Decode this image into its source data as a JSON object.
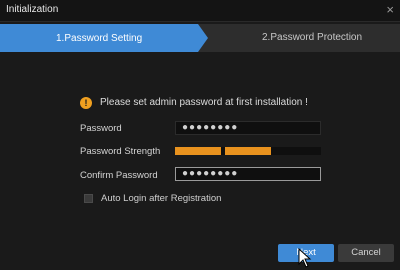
{
  "window": {
    "title": "Initialization",
    "close_glyph": "×"
  },
  "steps": [
    {
      "label": "1.Password Setting",
      "active": true
    },
    {
      "label": "2.Password Protection",
      "active": false
    }
  ],
  "notice": {
    "icon_glyph": "!",
    "text": "Please set admin password at first installation !"
  },
  "form": {
    "password_label": "Password",
    "password_value": "●●●●●●●●",
    "strength_label": "Password Strength",
    "strength_level": 0.66,
    "confirm_label": "Confirm Password",
    "confirm_value": "●●●●●●●●",
    "auto_login_label": "Auto Login after Registration",
    "auto_login_checked": false
  },
  "buttons": {
    "next": "Next",
    "cancel": "Cancel"
  },
  "colors": {
    "accent": "#3f8ad6",
    "strength": "#e8921e",
    "warning": "#f0a020",
    "background": "#1a1a1a"
  }
}
